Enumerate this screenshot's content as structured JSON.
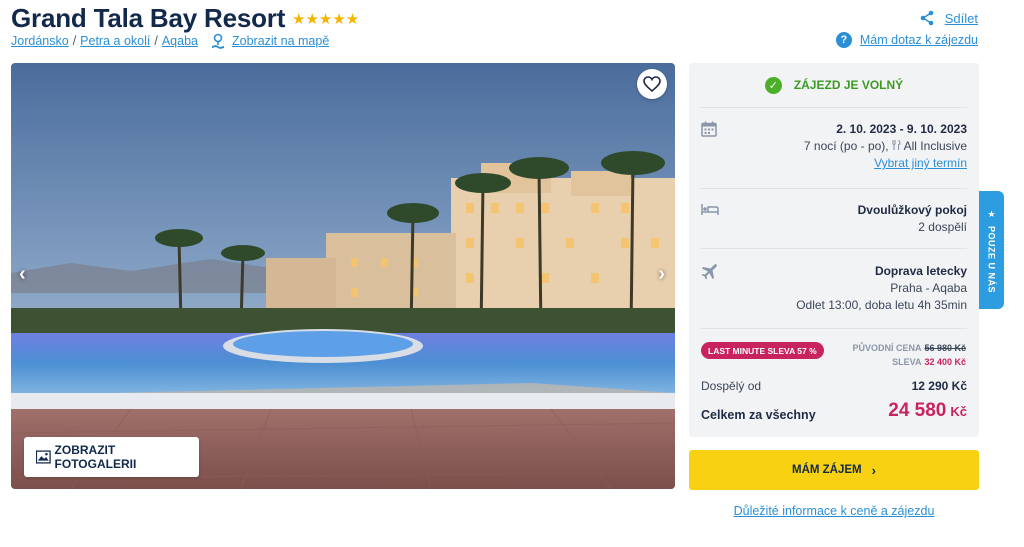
{
  "header": {
    "title": "Grand Tala Bay Resort",
    "stars": "★★★★★",
    "star_rating": 5,
    "breadcrumb": [
      "Jordánsko",
      "Petra a okolí",
      "Aqaba"
    ],
    "breadcrumb_sep": "/",
    "map_link": "Zobrazit na mapě",
    "share": "Sdílet",
    "question": "Mám dotaz k zájezdu",
    "question_icon": "?"
  },
  "gallery": {
    "prev_arrow": "‹",
    "next_arrow": "›",
    "button": "ZOBRAZIT FOTOGALERII"
  },
  "booking": {
    "availability": "ZÁJEZD JE VOLNÝ",
    "availability_check": "✓",
    "dates": "2. 10. 2023 - 9. 10. 2023",
    "nights": "7 nocí (po - po),",
    "board": "All Inclusive",
    "change_date": "Vybrat jiný termín",
    "room": "Dvoulůžkový pokoj",
    "guests": "2 dospělí",
    "transport": "Doprava letecky",
    "route": "Praha - Aqaba",
    "departure": "Odlet 13:00, doba letu 4h 35min",
    "badge": "LAST MINUTE SLEVA 57 %",
    "orig_label": "PŮVODNÍ CENA",
    "orig_price": "56 980 Kč",
    "disc_label": "SLEVA",
    "disc_price": "32 400 Kč",
    "adult_label": "Dospělý od",
    "adult_price": "12 290 Kč",
    "total_label": "Celkem za všechny",
    "total_price": "24 580",
    "total_currency": "Kč"
  },
  "side_tab": {
    "star": "★",
    "label": "POUZE U NÁS"
  },
  "cta": {
    "label": "MÁM ZÁJEM",
    "chevron": "›"
  },
  "info_link": "Důležité informace k ceně a zájezdu",
  "colors": {
    "accent": "#2b8fd8",
    "price": "#c8235f",
    "cta": "#f7d112",
    "ok": "#4caf2a"
  }
}
